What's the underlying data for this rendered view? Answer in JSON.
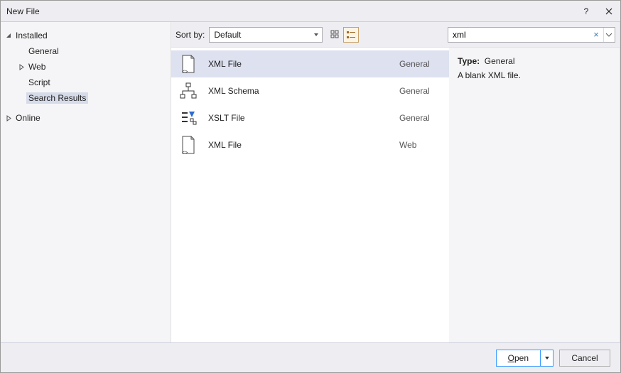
{
  "window": {
    "title": "New File"
  },
  "sidebar": {
    "installed": "Installed",
    "items": [
      {
        "label": "General",
        "expandable": false
      },
      {
        "label": "Web",
        "expandable": true
      },
      {
        "label": "Script",
        "expandable": false
      },
      {
        "label": "Search Results",
        "expandable": false,
        "selected": true
      }
    ],
    "online": "Online"
  },
  "toolbar": {
    "sortby_label": "Sort by:",
    "sort_value": "Default",
    "search_value": "xml"
  },
  "templates": [
    {
      "name": "XML File",
      "category": "General",
      "icon": "xml-file",
      "selected": true
    },
    {
      "name": "XML Schema",
      "category": "General",
      "icon": "xml-schema"
    },
    {
      "name": "XSLT File",
      "category": "General",
      "icon": "xslt-file"
    },
    {
      "name": "XML File",
      "category": "Web",
      "icon": "xml-file"
    }
  ],
  "details": {
    "type_label": "Type:",
    "type_value": "General",
    "description": "A blank XML file."
  },
  "footer": {
    "open": "Open",
    "cancel": "Cancel"
  }
}
